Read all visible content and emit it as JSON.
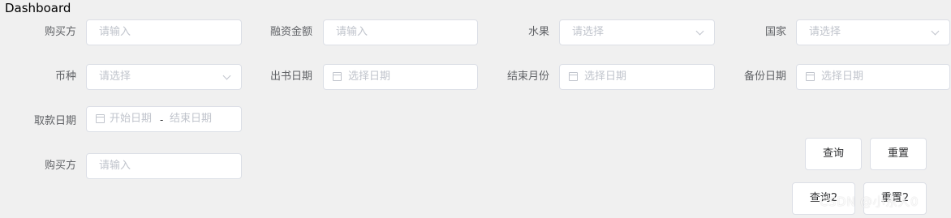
{
  "page": {
    "title": "Dashboard"
  },
  "row1": {
    "buyer": {
      "label": "购买方",
      "placeholder": "请输入"
    },
    "financing_amount": {
      "label": "融资金额",
      "placeholder": "请输入"
    },
    "fruit": {
      "label": "水果",
      "placeholder": "请选择"
    },
    "country": {
      "label": "国家",
      "placeholder": "请选择"
    }
  },
  "row2": {
    "currency": {
      "label": "币种",
      "placeholder": "请选择"
    },
    "issue_date": {
      "label": "出书日期",
      "placeholder": "选择日期"
    },
    "end_month": {
      "label": "结束月份",
      "placeholder": "选择日期"
    },
    "backup_date": {
      "label": "备份日期",
      "placeholder": "选择日期"
    }
  },
  "row3": {
    "withdraw_date": {
      "label": "取款日期",
      "start_placeholder": "开始日期",
      "separator": "-",
      "end_placeholder": "结束日期"
    }
  },
  "row4": {
    "buyer": {
      "label": "购买方",
      "placeholder": "请输入"
    }
  },
  "actions": {
    "query_label": "查询",
    "reset_label": "重置",
    "query2_label": "查询2",
    "reset2_label": "重置2"
  },
  "watermark": "CSDN @小东人0",
  "icons": [
    "calendar-icon",
    "chevron-down-icon"
  ]
}
